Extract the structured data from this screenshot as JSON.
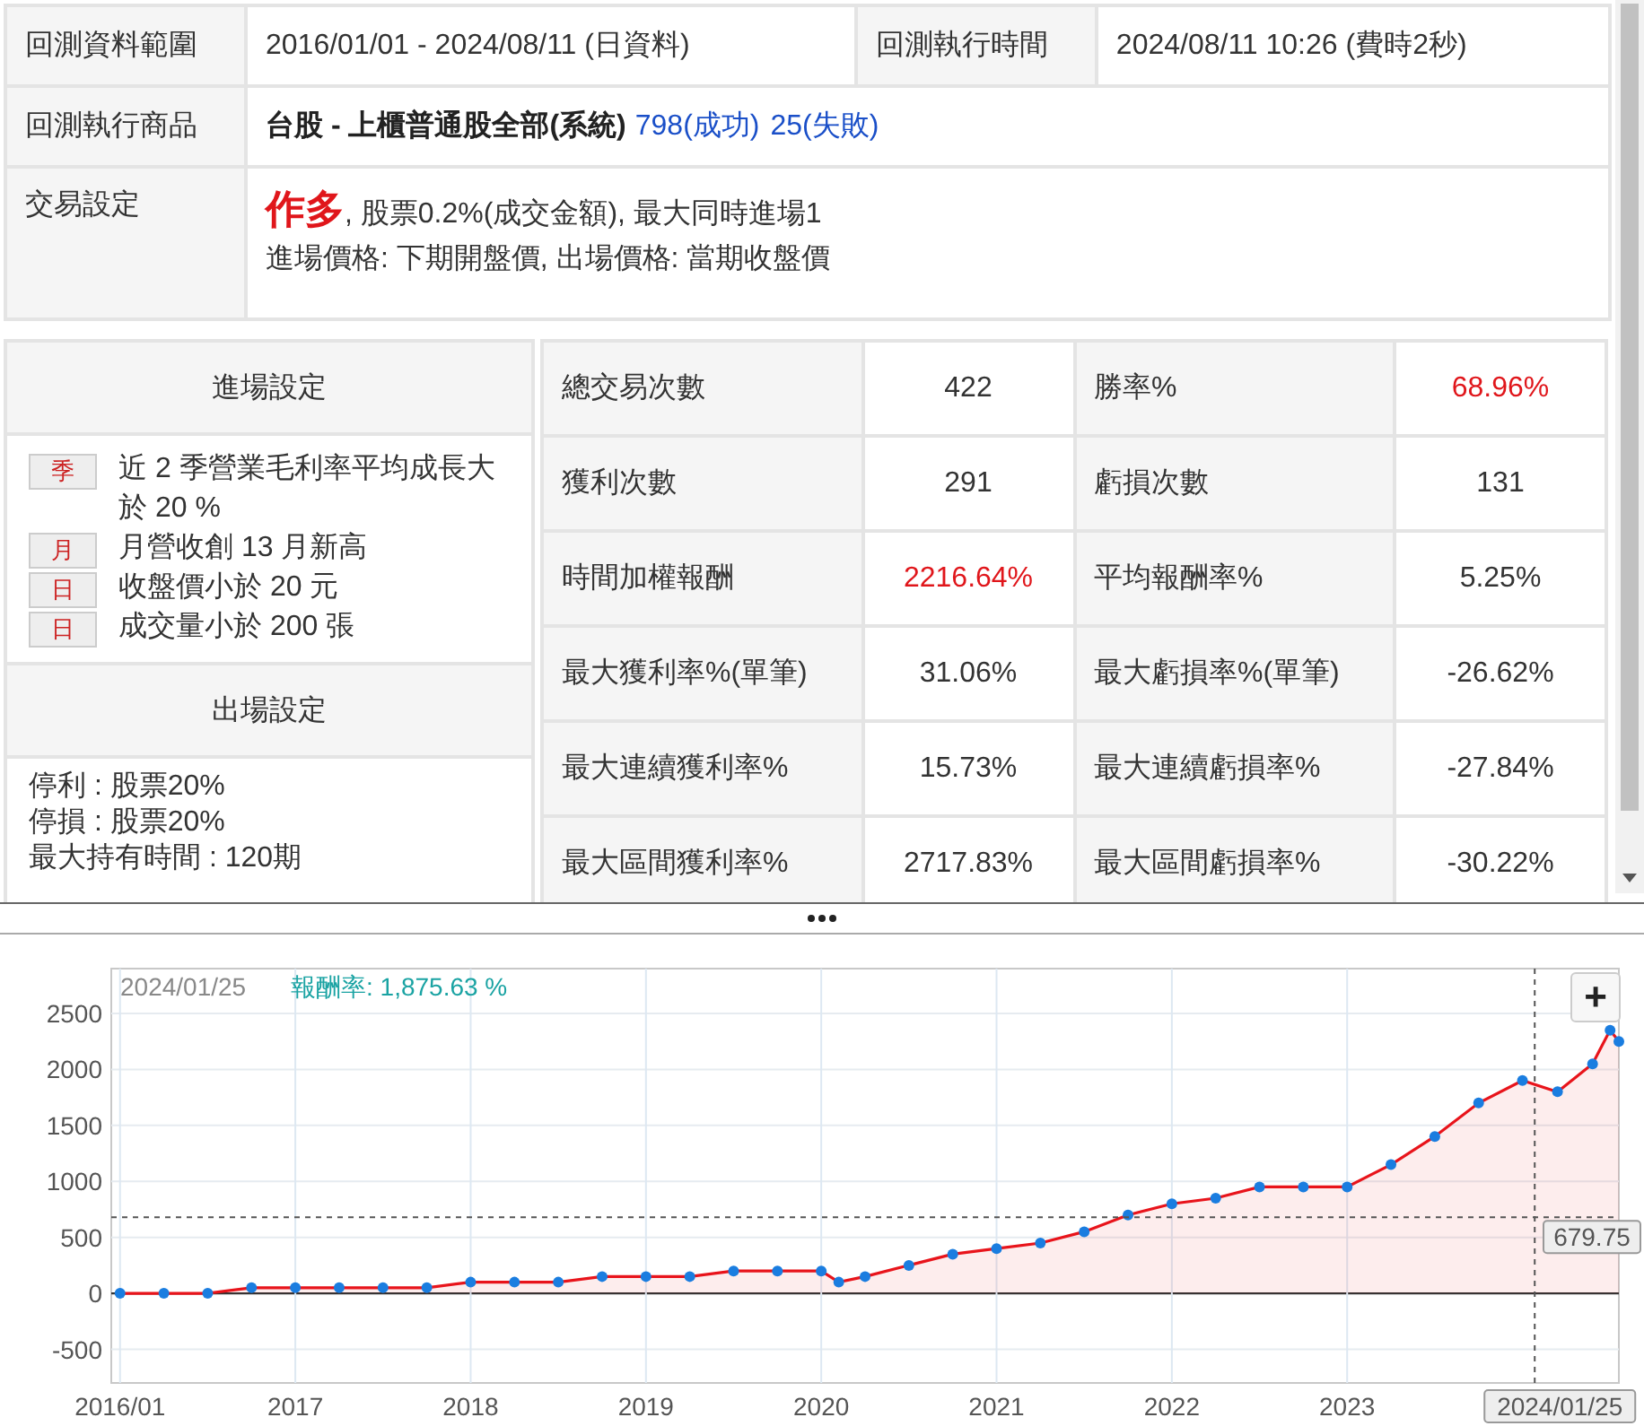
{
  "info": {
    "rows": [
      {
        "cells": [
          {
            "kind": "label",
            "text": "回測資料範圍"
          },
          {
            "kind": "value",
            "text": "2016/01/01 - 2024/08/11 (日資料)"
          },
          {
            "kind": "label",
            "text": "回測執行時間"
          },
          {
            "kind": "value",
            "text": "2024/08/11 10:26 (費時2秒)"
          }
        ]
      },
      {
        "cells": [
          {
            "kind": "label",
            "text": "回測執行商品"
          },
          {
            "kind": "product",
            "colspan": 3,
            "product": "台股 - 上櫃普通股全部(系統)",
            "links": [
              "798(成功)",
              "25(失敗)"
            ]
          }
        ]
      },
      {
        "cells": [
          {
            "kind": "label",
            "text": "交易設定"
          },
          {
            "kind": "trade",
            "colspan": 3,
            "direction": "作多",
            "text": ", 股票0.2%(成交金額), 最大同時進場1",
            "second_line": "進場價格: 下期開盤價, 出場價格: 當期收盤價"
          }
        ]
      }
    ]
  },
  "entry": {
    "title": "進場設定",
    "conditions": [
      {
        "period": "季",
        "text": "近 2 季營業毛利率平均成長大於 20 %"
      },
      {
        "period": "月",
        "text": "月營收創 13 月新高"
      },
      {
        "period": "日",
        "text": "收盤價小於 20 元"
      },
      {
        "period": "日",
        "text": "成交量小於 200 張"
      }
    ]
  },
  "exit": {
    "title": "出場設定",
    "lines": [
      "停利 : 股票20%",
      "停損 : 股票20%",
      "最大持有時間 : 120期"
    ]
  },
  "stats": [
    [
      {
        "label": "總交易次數",
        "value": "422",
        "highlight": false
      },
      {
        "label": "勝率%",
        "value": "68.96%",
        "highlight": true
      }
    ],
    [
      {
        "label": "獲利次數",
        "value": "291",
        "highlight": false
      },
      {
        "label": "虧損次數",
        "value": "131",
        "highlight": false
      }
    ],
    [
      {
        "label": "時間加權報酬",
        "value": "2216.64%",
        "highlight": true
      },
      {
        "label": "平均報酬率%",
        "value": "5.25%",
        "highlight": false
      }
    ],
    [
      {
        "label": "最大獲利率%(單筆)",
        "value": "31.06%",
        "highlight": false
      },
      {
        "label": "最大虧損率%(單筆)",
        "value": "-26.62%",
        "highlight": false
      }
    ],
    [
      {
        "label": "最大連續獲利率%",
        "value": "15.73%",
        "highlight": false
      },
      {
        "label": "最大連續虧損率%",
        "value": "-27.84%",
        "highlight": false
      }
    ],
    [
      {
        "label": "最大區間獲利率%",
        "value": "2717.83%",
        "highlight": false
      },
      {
        "label": "最大區間虧損率%",
        "value": "-30.22%",
        "highlight": false
      }
    ]
  ],
  "chart": {
    "header_date": "2024/01/25",
    "header_value": "報酬率: 1,875.63 %",
    "zoom_button": "+",
    "chart_data": {
      "type": "area",
      "grid": true,
      "ref_lines": [
        {
          "axis": "x",
          "value": 2024.07
        },
        {
          "axis": "y",
          "value": 679.75
        }
      ],
      "xlim": [
        2015.95,
        2024.55
      ],
      "ylim": [
        -800,
        2900
      ],
      "xticks": [
        {
          "value": 2016,
          "label": "2016/01"
        },
        2017,
        2018,
        2019,
        2020,
        2021,
        2022,
        2023
      ],
      "yticks": [
        -500,
        0,
        500,
        1000,
        1500,
        2000,
        2500
      ],
      "x": [
        2016,
        2016.25,
        2016.5,
        2016.75,
        2017,
        2017.25,
        2017.5,
        2017.75,
        2018,
        2018.25,
        2018.5,
        2018.75,
        2019,
        2019.25,
        2019.5,
        2019.75,
        2020,
        2020.1,
        2020.25,
        2020.5,
        2020.75,
        2021,
        2021.25,
        2021.5,
        2021.75,
        2022,
        2022.25,
        2022.5,
        2022.75,
        2023,
        2023.25,
        2023.5,
        2023.75,
        2024,
        2024.2,
        2024.4,
        2024.5,
        2024.55
      ],
      "series": [
        {
          "color": "#e8141b",
          "marker": true,
          "values": [
            0,
            0,
            0,
            50,
            50,
            50,
            50,
            50,
            100,
            100,
            100,
            150,
            150,
            150,
            200,
            200,
            200,
            100,
            150,
            250,
            350,
            400,
            450,
            550,
            700,
            800,
            850,
            950,
            950,
            950,
            1150,
            1400,
            1700,
            1900,
            1800,
            2050,
            2350,
            2250
          ]
        }
      ]
    },
    "crosshair": {
      "x_label": "2024/01/25",
      "y_label": "679.75"
    }
  }
}
